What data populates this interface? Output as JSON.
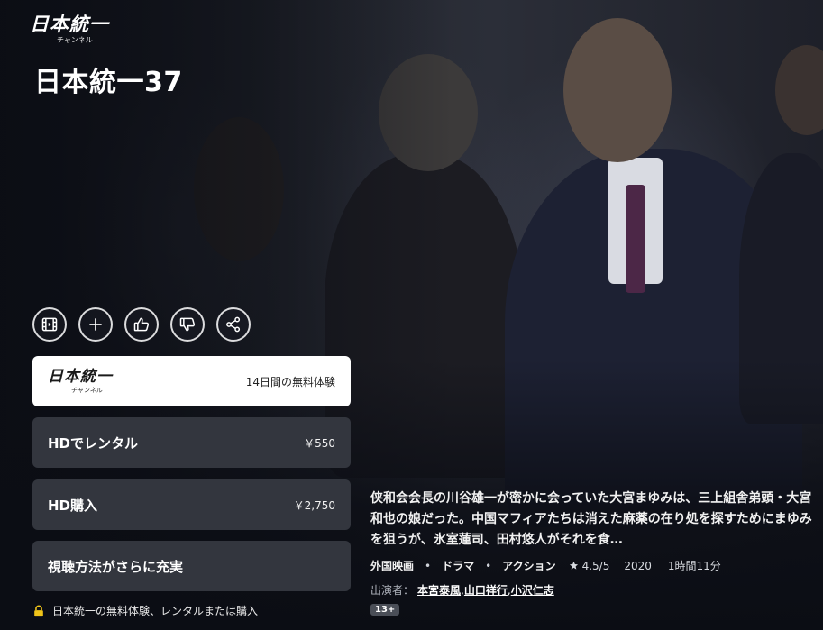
{
  "channel": {
    "logo_main": "日本統一",
    "logo_sub": "チャンネル"
  },
  "title": "日本統一37",
  "actions": [
    {
      "name": "trailer",
      "icon": "film-icon"
    },
    {
      "name": "add-to-watchlist",
      "icon": "plus-icon"
    },
    {
      "name": "like",
      "icon": "thumbs-up-icon"
    },
    {
      "name": "dislike",
      "icon": "thumbs-down-icon"
    },
    {
      "name": "share",
      "icon": "share-icon"
    }
  ],
  "options": {
    "channel_trial": {
      "logo_main": "日本統一",
      "logo_sub": "チャンネル",
      "label": "14日間の無料体験"
    },
    "rent": {
      "label": "HDでレンタル",
      "price": "￥550"
    },
    "buy": {
      "label": "HD購入",
      "price": "￥2,750"
    },
    "more": {
      "label": "視聴方法がさらに充実"
    }
  },
  "notice": "日本統一の無料体験、レンタルまたは購入",
  "synopsis": "侠和会会長の川谷雄一が密かに会っていた大宮まゆみは、三上組舎弟頭・大宮和也の娘だった。中国マフィアたちは消えた麻薬の在り処を探すためにまゆみを狙うが、氷室蓮司、田村悠人がそれを食…",
  "meta": {
    "genres": [
      "外国映画",
      "ドラマ",
      "アクション"
    ],
    "separator": "•",
    "rating": "4.5/5",
    "year": "2020",
    "duration": "1時間11分"
  },
  "cast": {
    "label": "出演者：",
    "names": [
      "本宮泰風",
      "山口祥行",
      "小沢仁志"
    ],
    "separator": ", "
  },
  "age_rating": "13+",
  "colors": {
    "background": "#0b0d14",
    "card_dark": "#33363e",
    "card_light": "#ffffff",
    "badge": "#4a4e57",
    "lock_gold": "#f0c419"
  }
}
